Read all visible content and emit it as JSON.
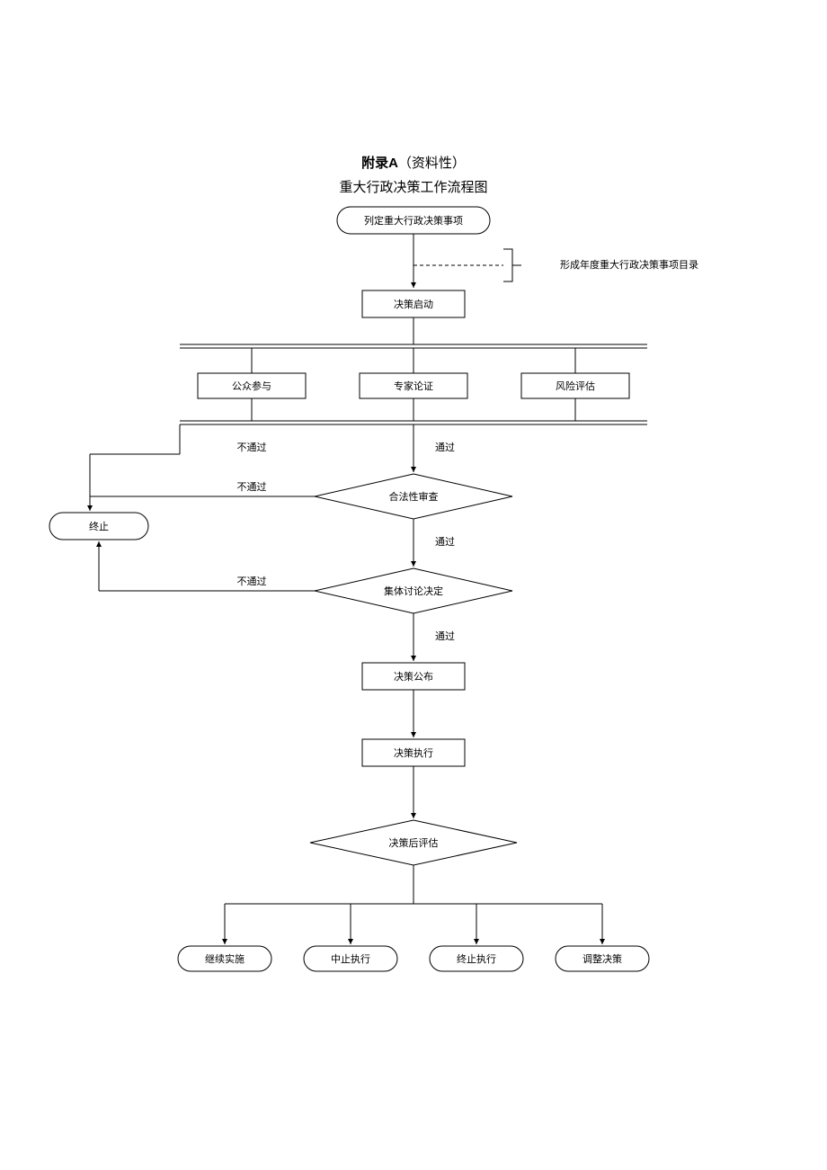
{
  "header": {
    "appendix_prefix": "附录A",
    "appendix_suffix": "（资料性）",
    "title": "重大行政决策工作流程图"
  },
  "nodes": {
    "start": "列定重大行政决策事项",
    "side_catalog": "形成年度重大行政决策事项目录",
    "initiate": "决策启动",
    "public": "公众参与",
    "expert": "专家论证",
    "risk": "风险评估",
    "legal_review": "合法性审查",
    "collective": "集体讨论决定",
    "terminate": "终止",
    "publish": "决策公布",
    "execute": "决策执行",
    "post_eval": "决策后评估",
    "out_continue": "继续实施",
    "out_pause": "中止执行",
    "out_stop": "终止执行",
    "out_adjust": "调整决策"
  },
  "edges": {
    "pass": "通过",
    "fail": "不通过"
  },
  "chart_data": {
    "type": "flowchart",
    "title": "重大行政决策工作流程图",
    "nodes": [
      {
        "id": "start",
        "label": "列定重大行政决策事项",
        "shape": "terminator"
      },
      {
        "id": "catalog",
        "label": "形成年度重大行政决策事项目录",
        "shape": "annotation",
        "attached_to": "start"
      },
      {
        "id": "initiate",
        "label": "决策启动",
        "shape": "process"
      },
      {
        "id": "public",
        "label": "公众参与",
        "shape": "process"
      },
      {
        "id": "expert",
        "label": "专家论证",
        "shape": "process"
      },
      {
        "id": "risk",
        "label": "风险评估",
        "shape": "process"
      },
      {
        "id": "legal",
        "label": "合法性审查",
        "shape": "decision"
      },
      {
        "id": "collective",
        "label": "集体讨论决定",
        "shape": "decision"
      },
      {
        "id": "terminate",
        "label": "终止",
        "shape": "terminator"
      },
      {
        "id": "publish",
        "label": "决策公布",
        "shape": "process"
      },
      {
        "id": "execute",
        "label": "决策执行",
        "shape": "process"
      },
      {
        "id": "posteval",
        "label": "决策后评估",
        "shape": "decision"
      },
      {
        "id": "continue",
        "label": "继续实施",
        "shape": "terminator"
      },
      {
        "id": "pause",
        "label": "中止执行",
        "shape": "terminator"
      },
      {
        "id": "stop",
        "label": "终止执行",
        "shape": "terminator"
      },
      {
        "id": "adjust",
        "label": "调整决策",
        "shape": "terminator"
      }
    ],
    "edges": [
      {
        "from": "start",
        "to": "initiate"
      },
      {
        "from": "start",
        "to": "catalog",
        "style": "dashed"
      },
      {
        "from": "initiate",
        "to": "public"
      },
      {
        "from": "initiate",
        "to": "expert"
      },
      {
        "from": "initiate",
        "to": "risk"
      },
      {
        "from": "public",
        "to": "legal"
      },
      {
        "from": "expert",
        "to": "legal"
      },
      {
        "from": "risk",
        "to": "legal"
      },
      {
        "from": "public/expert/risk",
        "to": "terminate",
        "label": "不通过"
      },
      {
        "from": "legal",
        "to": "collective",
        "label": "通过"
      },
      {
        "from": "legal",
        "to": "terminate",
        "label": "不通过"
      },
      {
        "from": "collective",
        "to": "publish",
        "label": "通过"
      },
      {
        "from": "collective",
        "to": "terminate",
        "label": "不通过"
      },
      {
        "from": "publish",
        "to": "execute"
      },
      {
        "from": "execute",
        "to": "posteval"
      },
      {
        "from": "posteval",
        "to": "continue"
      },
      {
        "from": "posteval",
        "to": "pause"
      },
      {
        "from": "posteval",
        "to": "stop"
      },
      {
        "from": "posteval",
        "to": "adjust"
      }
    ]
  }
}
